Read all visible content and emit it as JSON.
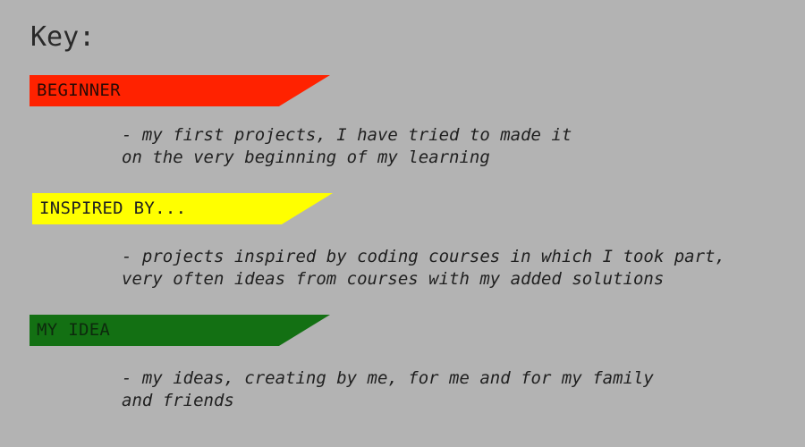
{
  "title": "Key:",
  "levels": [
    {
      "label": "BEGINNER",
      "color": "#ff2200",
      "text_color": "#2a0b05",
      "desc_lines": [
        "- my first projects, I have tried to made it",
        "on the very beginning of my learning"
      ]
    },
    {
      "label": "INSPIRED BY...",
      "color": "#ffff00",
      "text_color": "#1f1f1f",
      "desc_lines": [
        "- projects inspired by coding courses in which I took part,",
        "very often ideas from courses with my added solutions"
      ]
    },
    {
      "label": "MY IDEA",
      "color": "#137013",
      "text_color": "#0d2a0d",
      "desc_lines": [
        "- my ideas, creating by me, for me and for my family",
        "and friends"
      ]
    }
  ]
}
